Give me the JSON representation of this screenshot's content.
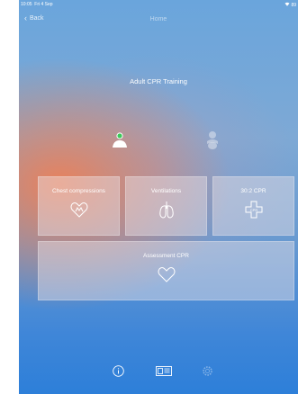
{
  "status_bar": {
    "time": "10:05",
    "date": "Fri 4 Sep",
    "battery": "89"
  },
  "nav": {
    "back_label": "Back",
    "title": "Home"
  },
  "app_title": "Adult CPR Training",
  "modes": {
    "adult": "adult-icon",
    "infant": "infant-icon"
  },
  "tiles": [
    {
      "label": "Chest compressions",
      "icon": "heart-hands-icon"
    },
    {
      "label": "Ventilations",
      "icon": "lungs-icon"
    },
    {
      "label": "30:2 CPR",
      "icon": "cpr-cross-icon"
    },
    {
      "label": "Assessment CPR",
      "icon": "heart-icon"
    }
  ],
  "bottom_bar": {
    "info": "info-icon",
    "manual": "manual-icon",
    "settings": "settings-icon"
  },
  "colors": {
    "gradient_top": "#6aa5dc",
    "gradient_bottom": "#2d7fd9",
    "glow": "#ee8056",
    "active_dot": "#3dc85a"
  }
}
